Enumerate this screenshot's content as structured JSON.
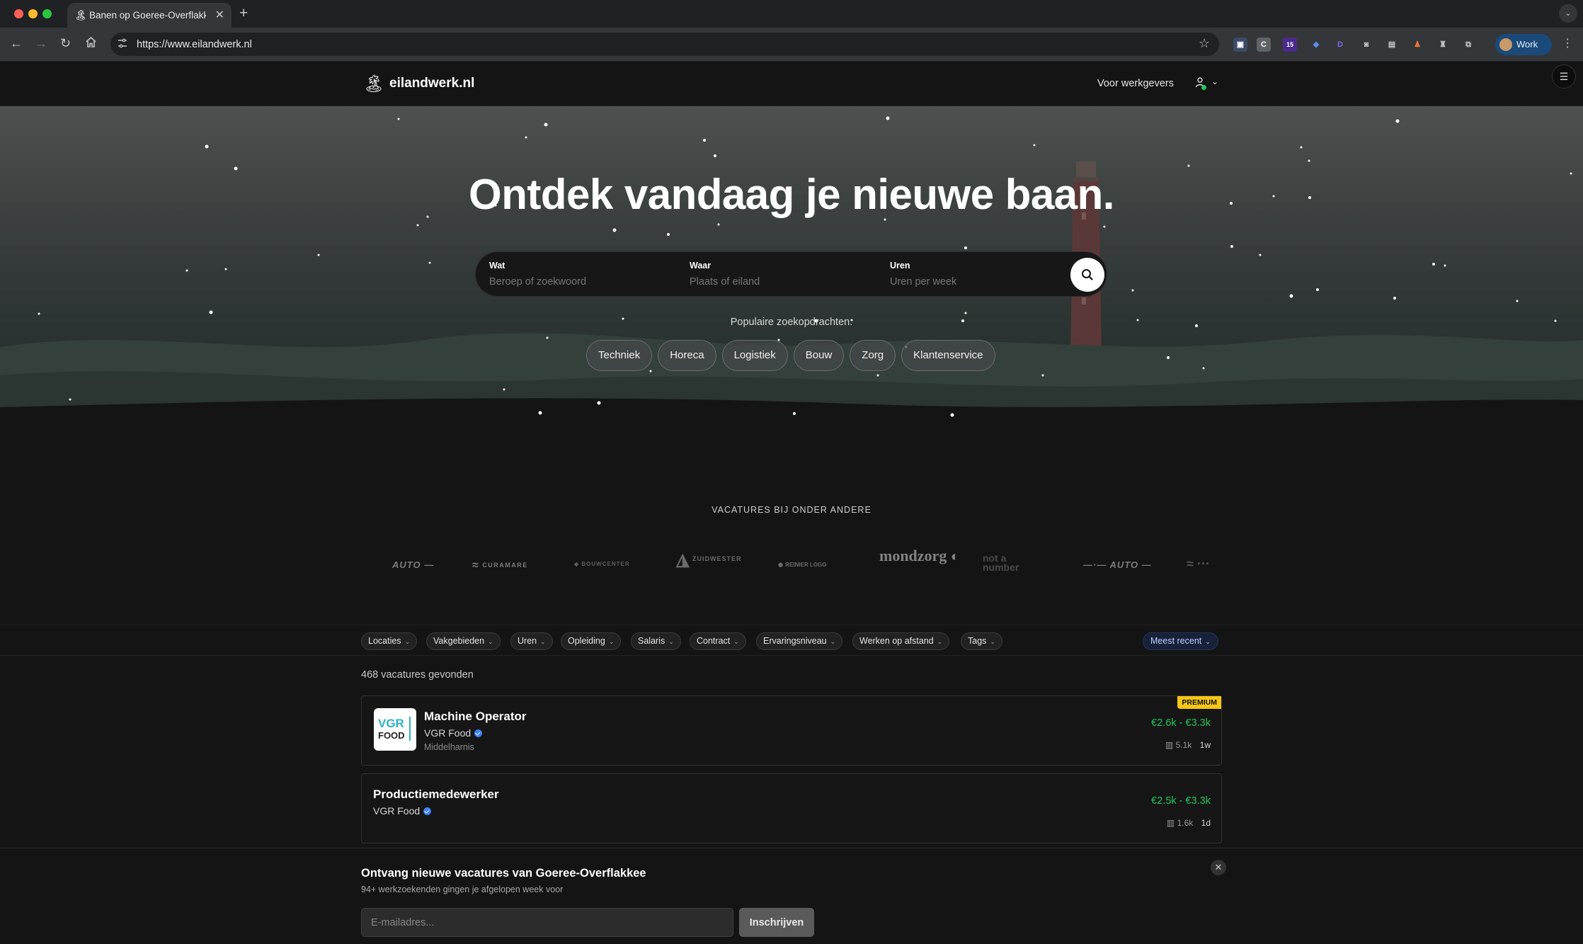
{
  "browser": {
    "tab_title": "Banen op Goeree-Overflakkee",
    "url": "https://www.eilandwerk.nl",
    "profile_label": "Work",
    "extension_badge": "15"
  },
  "header": {
    "logo_text": "eilandwerk.nl",
    "employers_link": "Voor werkgevers"
  },
  "hero": {
    "title": "Ontdek vandaag je nieuwe baan.",
    "search": {
      "what_label": "Wat",
      "what_placeholder": "Beroep of zoekwoord",
      "where_label": "Waar",
      "where_placeholder": "Plaats of eiland",
      "hours_label": "Uren",
      "hours_placeholder": "Uren per week"
    },
    "popular_label": "Populaire zoekopdrachten:",
    "popular": [
      "Techniek",
      "Horeca",
      "Logistiek",
      "Bouw",
      "Zorg",
      "Klantenservice"
    ]
  },
  "companies": {
    "title": "VACATURES BIJ ONDER ANDERE",
    "logos": [
      "AUTO",
      "CURAMARE",
      "BOUWCENTER",
      "ZUIDWESTER",
      "REINIER LOGO",
      "mondzorg",
      "not a number",
      "AUTO"
    ]
  },
  "filters": {
    "items": [
      "Locaties",
      "Vakgebieden",
      "Uren",
      "Opleiding",
      "Salaris",
      "Contract",
      "Ervaringsniveau",
      "Werken op afstand",
      "Tags"
    ],
    "sort": "Meest recent"
  },
  "results": {
    "count_text": "468 vacatures gevonden",
    "jobs": [
      {
        "title": "Machine Operator",
        "company": "VGR Food",
        "location": "Middelharnis",
        "badge": "PREMIUM",
        "salary": "€2.6k - €3.3k",
        "views": "5.1k",
        "age": "1w",
        "logo_line1": "VGR",
        "logo_line2": "FOOD"
      },
      {
        "title": "Productiemedewerker",
        "company": "VGR Food",
        "salary": "€2.5k - €3.3k",
        "views": "1.6k",
        "age": "1d"
      }
    ]
  },
  "newsletter": {
    "title": "Ontvang nieuwe vacatures van Goeree-Overflakkee",
    "subtitle": "94+ werkzoekenden gingen je afgelopen week voor",
    "email_placeholder": "E-mailadres...",
    "button": "Inschrijven"
  },
  "colors": {
    "accent_green": "#22c55e",
    "premium_yellow": "#f5c518",
    "verified_blue": "#3b82f6",
    "background": "#141414"
  },
  "icons": [
    "palm-tree-icon",
    "user-icon",
    "search-icon",
    "close-icon",
    "chevron-down-icon",
    "views-chart-icon",
    "verified-icon"
  ]
}
